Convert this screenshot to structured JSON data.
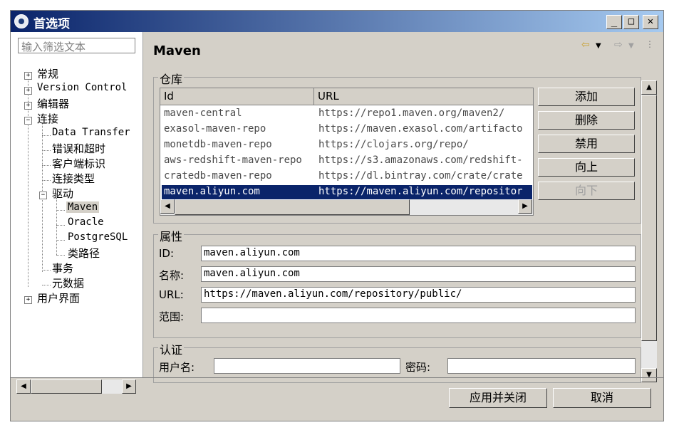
{
  "window": {
    "title": "首选项",
    "minimize": "_",
    "maximize": "□",
    "close": "✕"
  },
  "filter": {
    "placeholder": "输入筛选文本"
  },
  "tree": {
    "general": "常规",
    "version_control": "Version Control",
    "editors": "编辑器",
    "connections": "连接",
    "data_transfer": "Data Transfer",
    "errors_timeouts": "错误和超时",
    "client_id": "客户端标识",
    "connection_types": "连接类型",
    "drivers": "驱动",
    "maven": "Maven",
    "oracle": "Oracle",
    "postgresql": "PostgreSQL",
    "classpath": "类路径",
    "transactions": "事务",
    "metadata": "元数据",
    "ui": "用户界面"
  },
  "page": {
    "title": "Maven"
  },
  "repo": {
    "group_label": "仓库",
    "col_id": "Id",
    "col_url": "URL",
    "rows": [
      {
        "id": "maven-central",
        "url": "https://repo1.maven.org/maven2/"
      },
      {
        "id": "exasol-maven-repo",
        "url": "https://maven.exasol.com/artifacto"
      },
      {
        "id": "monetdb-maven-repo",
        "url": "https://clojars.org/repo/"
      },
      {
        "id": "aws-redshift-maven-repo",
        "url": "https://s3.amazonaws.com/redshift-"
      },
      {
        "id": "cratedb-maven-repo",
        "url": "https://dl.bintray.com/crate/crate"
      },
      {
        "id": "maven.aliyun.com",
        "url": "https://maven.aliyun.com/repositor"
      }
    ],
    "selected_index": 5,
    "buttons": {
      "add": "添加",
      "delete": "删除",
      "disable": "禁用",
      "up": "向上",
      "down": "向下"
    }
  },
  "props": {
    "group_label": "属性",
    "id_label": "ID:",
    "id_value": "maven.aliyun.com",
    "name_label": "名称:",
    "name_value": "maven.aliyun.com",
    "url_label": "URL:",
    "url_value": "https://maven.aliyun.com/repository/public/",
    "scope_label": "范围:",
    "scope_value": ""
  },
  "auth": {
    "group_label": "认证",
    "user_label": "用户名:",
    "user_value": "",
    "pass_label": "密码:",
    "pass_value": ""
  },
  "footer": {
    "apply_close": "应用并关闭",
    "cancel": "取消"
  },
  "colors": {
    "selection": "#0a246a",
    "window_bg": "#d4d0c8"
  }
}
